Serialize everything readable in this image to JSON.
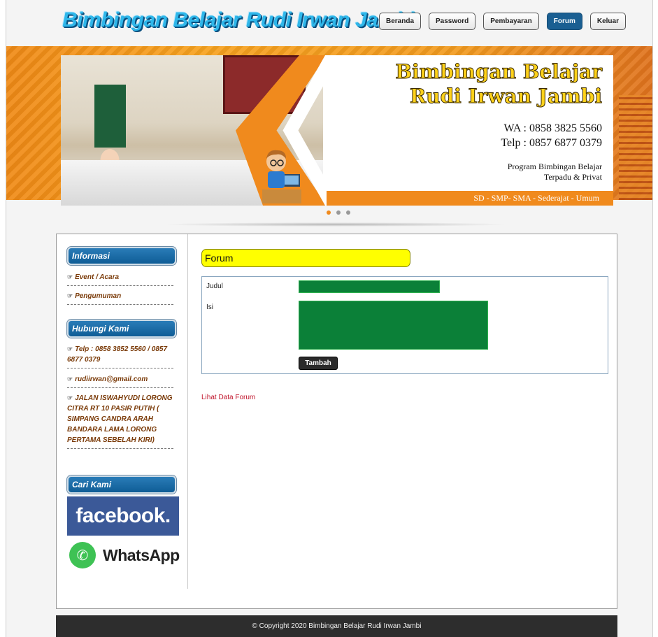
{
  "header": {
    "logo_text": "Bimbingan Belajar Rudi Irwan Jambi",
    "nav": [
      {
        "label": "Beranda"
      },
      {
        "label": "Password"
      },
      {
        "label": "Pembayaran"
      },
      {
        "label": "Forum",
        "active": true
      },
      {
        "label": "Keluar"
      }
    ]
  },
  "banner": {
    "title_line1": "Bimbingan Belajar",
    "title_line2": "Rudi Irwan Jambi",
    "wa": "WA : 0858 3825 5560",
    "telp": "Telp : 0857 6877 0379",
    "program_line1": "Program Bimbingan Belajar",
    "program_line2": "Terpadu & Privat",
    "levels": "SD - SMP- SMA - Sederajat - Umum",
    "slides_total": 3,
    "active_slide": 1,
    "accent_color": "#f08a1d"
  },
  "sidebar": {
    "informasi_title": "Informasi",
    "informasi_items": [
      "Event / Acara",
      "Pengumuman"
    ],
    "hubungi_title": "Hubungi Kami",
    "telp": "Telp : 0858 3852 5560 / 0857 6877 0379",
    "email": "rudiirwan@gmail.com",
    "alamat": "JALAN ISWAHYUDI LORONG CITRA RT 10 PASIR PUTIH ( SIMPANG CANDRA ARAH BANDARA LAMA LORONG PERTAMA SEBELAH KIRI)",
    "cari_title": "Cari Kami",
    "facebook": "facebook.",
    "whatsapp": "WhatsApp",
    "item_icon": "pointing-hand-icon"
  },
  "main": {
    "heading": "Forum",
    "label_judul": "Judul",
    "value_judul": "",
    "label_isi": "Isi",
    "value_isi": "",
    "button_tambah": "Tambah",
    "link_lihat": "Lihat Data Forum",
    "input_color": "#0b8038"
  },
  "footer": {
    "copyright": "© Copyright 2020 Bimbingan Belajar Rudi Irwan Jambi"
  }
}
